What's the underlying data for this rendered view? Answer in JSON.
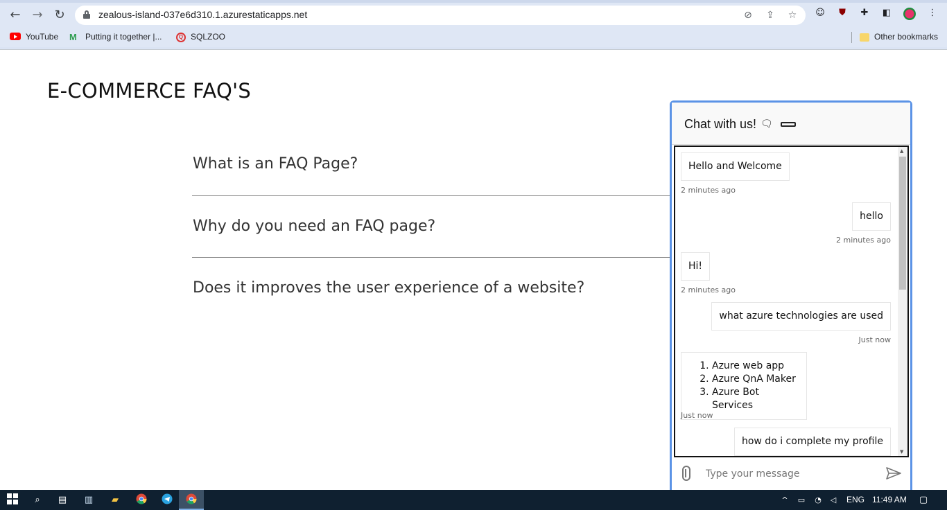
{
  "browser": {
    "url": "zealous-island-037e6d310.1.azurestaticapps.net",
    "bookmarks": [
      {
        "label": "YouTube",
        "icon": "youtube-icon"
      },
      {
        "label": "Putting it together |...",
        "icon": "gmail-icon"
      },
      {
        "label": "SQLZOO",
        "icon": "sqlzoo-icon"
      }
    ],
    "other_bookmarks": "Other bookmarks"
  },
  "page": {
    "title": "E-COMMERCE FAQ'S",
    "faqs": [
      "What is an FAQ Page?",
      "Why do you need an FAQ page?",
      "Does it improves the user experience of a website?"
    ]
  },
  "chat": {
    "title": "Chat with us!",
    "messages": [
      {
        "from": "bot",
        "text": "Hello and Welcome",
        "time": "2 minutes ago"
      },
      {
        "from": "user",
        "text": "hello",
        "time": "2 minutes ago"
      },
      {
        "from": "bot",
        "text": "Hi!",
        "time": "2 minutes ago"
      },
      {
        "from": "user",
        "text": "what azure technologies are used",
        "time": "Just now"
      },
      {
        "from": "bot",
        "list": [
          "Azure web app",
          "Azure QnA Maker",
          "Azure Bot Services"
        ],
        "time": "Just now"
      },
      {
        "from": "user",
        "text": "how do i complete my profile"
      }
    ],
    "input_placeholder": "Type your message"
  },
  "taskbar": {
    "language": "ENG",
    "time": "11:49 AM"
  },
  "colors": {
    "chat_border": "#5b93e6",
    "taskbar_bg": "#0f2030"
  }
}
